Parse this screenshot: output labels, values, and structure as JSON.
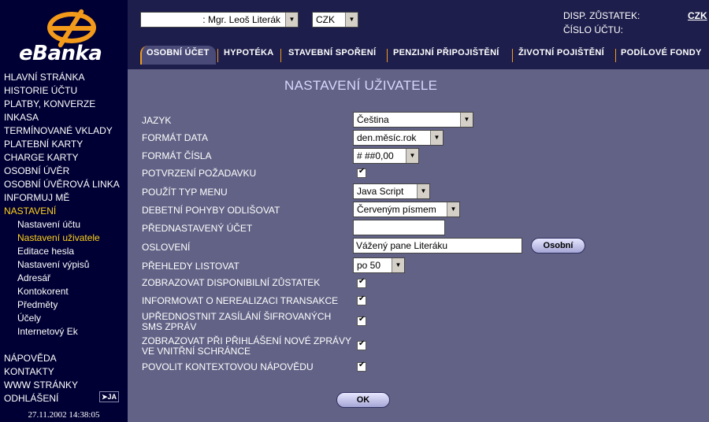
{
  "brand": {
    "name": "eBanka",
    "logo_icon": "ebanka-logo-icon"
  },
  "sidebar": {
    "items": [
      "HLAVNÍ STRÁNKA",
      "HISTORIE ÚČTU",
      "PLATBY, KONVERZE",
      "INKASA",
      "TERMÍNOVANÉ VKLADY",
      "PLATEBNÍ KARTY",
      "CHARGE KARTY",
      "OSOBNÍ ÚVĚR",
      "OSOBNÍ ÚVĚROVÁ LINKA",
      "INFORMUJ MĚ",
      "NASTAVENÍ"
    ],
    "subitems": [
      "Nastavení účtu",
      "Nastavení uživatele",
      "Editace hesla",
      "Nastavení výpisů",
      "Adresář",
      "Kontokorent",
      "Předměty",
      "Účely",
      "Internetový Ek"
    ],
    "bottom_items": [
      "NÁPOVĚDA",
      "KONTAKTY",
      "WWW STRÁNKY",
      "ODHLÁŠENÍ"
    ],
    "ja_button": "➤JA",
    "timestamp": "27.11.2002 14:38:05"
  },
  "header": {
    "user_select": ": Mgr. Leoš Literák",
    "currency_select": "CZK",
    "disp_label": "DISP. ZŮSTATEK:",
    "cislo_label": "ČÍSLO ÚČTU:",
    "currency_link": "CZK"
  },
  "tabs": [
    "OSOBNÍ ÚČET",
    "HYPOTÉKA",
    "STAVEBNÍ SPOŘENÍ",
    "PENZIJNÍ PŘIPOJIŠTĚNÍ",
    "ŽIVOTNÍ POJIŠTĚNÍ",
    "PODÍLOVÉ FONDY"
  ],
  "form": {
    "title": "NASTAVENÍ UŽIVATELE",
    "jazyk": {
      "label": "JAZYK",
      "value": "Čeština"
    },
    "format_data": {
      "label": "FORMÁT DATA",
      "value": "den.měsíc.rok"
    },
    "format_cisla": {
      "label": "FORMÁT ČÍSLA",
      "value": "# ##0,00"
    },
    "potvrzeni": {
      "label": "POTVRZENÍ POŽADAVKU",
      "checked": true
    },
    "typ_menu": {
      "label": "POUŽÍT TYP MENU",
      "value": "Java Script"
    },
    "debetni": {
      "label": "DEBETNÍ POHYBY ODLIŠOVAT",
      "value": "Červeným písmem"
    },
    "prednastaveny": {
      "label": "PŘEDNASTAVENÝ ÚČET",
      "value": ""
    },
    "osloveni": {
      "label": "OSLOVENÍ",
      "value": "Vážený pane Literáku",
      "button": "Osobní"
    },
    "prehledy": {
      "label": "PŘEHLEDY LISTOVAT",
      "value": "po 50"
    },
    "zobrazovat_disp": {
      "label": "ZOBRAZOVAT DISPONIBILNÍ ZŮSTATEK",
      "checked": true
    },
    "informovat": {
      "label": "INFORMOVAT O NEREALIZACI TRANSAKCE",
      "checked": true
    },
    "upřednostnit": {
      "label_line1": "UPŘEDNOSTNIT ZASÍLÁNÍ ŠIFROVANÝCH",
      "label_line2": "SMS ZPRÁV",
      "checked": true
    },
    "zobrazovat_zpravy": {
      "label_line1": "ZOBRAZOVAT PŘI PŘIHLÁŠENÍ NOVÉ ZPRÁVY",
      "label_line2": "VE VNITŘNÍ SCHRÁNCE",
      "checked": true
    },
    "kontextova": {
      "label": "POVOLIT KONTEXTOVOU NÁPOVĚDU",
      "checked": true
    },
    "ok_button": "OK"
  },
  "colors": {
    "accent": "#f39a1b",
    "active_nav": "#ffd21a",
    "sidebar_bg": "#000034",
    "content_bg": "#626286"
  }
}
